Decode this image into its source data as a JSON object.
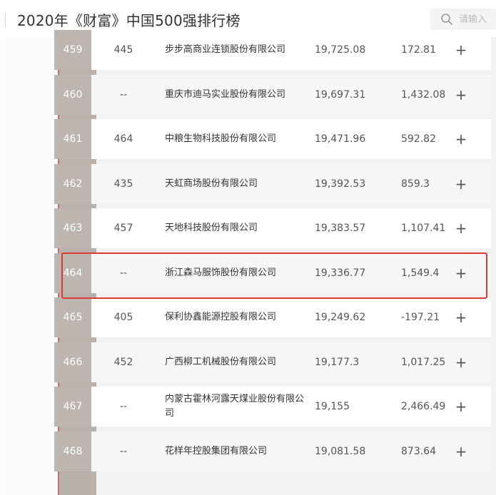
{
  "header": {
    "title": "2020年《财富》中国500强排行榜",
    "search_placeholder": "请输入"
  },
  "rows": [
    {
      "rank": "459",
      "prev_rank": "445",
      "company": "步步高商业连锁股份有限公司",
      "revenue": "19,725.08",
      "profit": "172.81"
    },
    {
      "rank": "460",
      "prev_rank": "--",
      "company": "重庆市迪马实业股份有限公司",
      "revenue": "19,697.31",
      "profit": "1,432.08"
    },
    {
      "rank": "461",
      "prev_rank": "464",
      "company": "中粮生物科技股份有限公司",
      "revenue": "19,471.96",
      "profit": "592.82"
    },
    {
      "rank": "462",
      "prev_rank": "435",
      "company": "天虹商场股份有限公司",
      "revenue": "19,392.53",
      "profit": "859.3"
    },
    {
      "rank": "463",
      "prev_rank": "457",
      "company": "天地科技股份有限公司",
      "revenue": "19,383.57",
      "profit": "1,107.41"
    },
    {
      "rank": "464",
      "prev_rank": "--",
      "company": "浙江森马服饰股份有限公司",
      "revenue": "19,336.77",
      "profit": "1,549.4"
    },
    {
      "rank": "465",
      "prev_rank": "405",
      "company": "保利协鑫能源控股有限公司",
      "revenue": "19,249.62",
      "profit": "-197.21"
    },
    {
      "rank": "466",
      "prev_rank": "452",
      "company": "广西柳工机械股份有限公司",
      "revenue": "19,177.3",
      "profit": "1,017.25"
    },
    {
      "rank": "467",
      "prev_rank": "--",
      "company": "内蒙古霍林河露天煤业股份有限公司",
      "revenue": "19,155",
      "profit": "2,466.49"
    },
    {
      "rank": "468",
      "prev_rank": "--",
      "company": "花样年控股集团有限公司",
      "revenue": "19,081.58",
      "profit": "873.64"
    }
  ],
  "expand_symbol": "+",
  "colors": {
    "rank_bg": "#bdb6b0",
    "accent_line": "#d46a6a",
    "highlight_box": "#e03a33"
  }
}
